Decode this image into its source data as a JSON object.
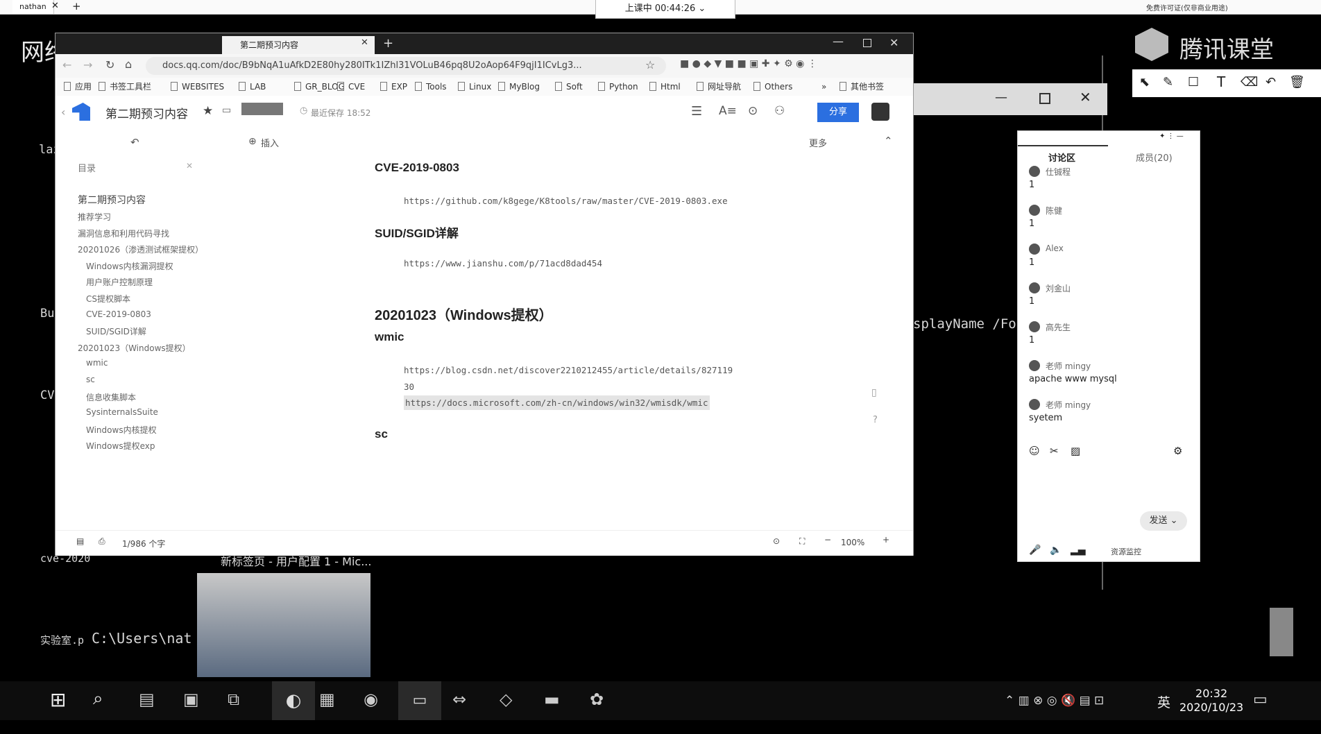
{
  "topbar": {
    "user_tab": "nathan",
    "class_status": "上课中 00:44:26",
    "license_text": "免费许可证(仅非商业用途)"
  },
  "desktop": {
    "banner_title": "网络安全就业推荐",
    "tencent_brand": "腾讯课堂",
    "left_labels": [
      "laz",
      "Bu",
      "CV",
      "cve-2020",
      "实验室.p"
    ],
    "terminal_path": "C:\\Users\\nat",
    "terminal_right_text": "splayName /Fo",
    "taskbar_preview_title": "新标签页 - 用户配置 1 - Mic..."
  },
  "browser": {
    "tab_title": "第二期预习内容",
    "url": "docs.qq.com/doc/B9bNqA1uAfkD2E80hy280ITk1IZhl31VOLuB46pq8U2oAop64F9qjI1ICvLg3...",
    "bookmarks": [
      "应用",
      "书签工具栏",
      "WEBSITES",
      "LAB",
      "GR_BLOG",
      "CVE",
      "EXP",
      "Tools",
      "Linux",
      "MyBlog",
      "Soft",
      "Python",
      "Html",
      "网址导航",
      "Others",
      "»",
      "其他书签"
    ]
  },
  "doc": {
    "title": "第二期预习内容",
    "saved_status": "最近保存 18:52",
    "share_label": "分享",
    "insert_label": "插入",
    "more_label": "更多",
    "outline_title": "目录",
    "outline": [
      {
        "label": "第二期预习内容",
        "level": 0
      },
      {
        "label": "推荐学习",
        "level": 1
      },
      {
        "label": "漏洞信息和利用代码寻找",
        "level": 1
      },
      {
        "label": "20201026（渗透测试框架提权）",
        "level": 1
      },
      {
        "label": "Windows内核漏洞提权",
        "level": 2
      },
      {
        "label": "用户账户控制原理",
        "level": 2
      },
      {
        "label": "CS提权脚本",
        "level": 2
      },
      {
        "label": "CVE-2019-0803",
        "level": 2
      },
      {
        "label": "SUID/SGID详解",
        "level": 2
      },
      {
        "label": "20201023（Windows提权）",
        "level": 1
      },
      {
        "label": "wmic",
        "level": 2
      },
      {
        "label": "sc",
        "level": 2
      },
      {
        "label": "信息收集脚本",
        "level": 2
      },
      {
        "label": "SysinternalsSuite",
        "level": 2
      },
      {
        "label": "Windows内核提权",
        "level": 2
      },
      {
        "label": "Windows提权exp",
        "level": 2
      }
    ],
    "content": {
      "h_cve": "CVE-2019-0803",
      "link_cve": "https://github.com/k8gege/K8tools/raw/master/CVE-2019-0803.exe",
      "h_suid": "SUID/SGID详解",
      "link_suid": "https://www.jianshu.com/p/71acd8dad454",
      "h_win": "20201023（Windows提权）",
      "h_wmic": "wmic",
      "link_wmic1a": "https://blog.csdn.net/discover2210212455/article/details/827119",
      "link_wmic1b": "30",
      "link_wmic2": "https://docs.microsoft.com/zh-cn/windows/win32/wmisdk/wmic",
      "h_sc": "sc"
    },
    "status": {
      "word_count": "1/986 个字",
      "zoom": "100%"
    }
  },
  "panel": {
    "tab_discuss": "讨论区",
    "tab_members": "成员(20)",
    "messages": [
      {
        "name": "仕铖程",
        "text": "1"
      },
      {
        "name": "陈健",
        "text": "1"
      },
      {
        "name": "Alex",
        "text": "1"
      },
      {
        "name": "刘金山",
        "text": "1"
      },
      {
        "name": "高先生",
        "text": "1"
      },
      {
        "name": "老师 mingy",
        "text": "apache www mysql"
      },
      {
        "name": "老师 mingy",
        "text": "syetem"
      }
    ],
    "send_label": "发送",
    "footer_label": "资源监控"
  },
  "taskbar": {
    "time": "20:32",
    "date": "2020/10/23",
    "ime": "英"
  }
}
